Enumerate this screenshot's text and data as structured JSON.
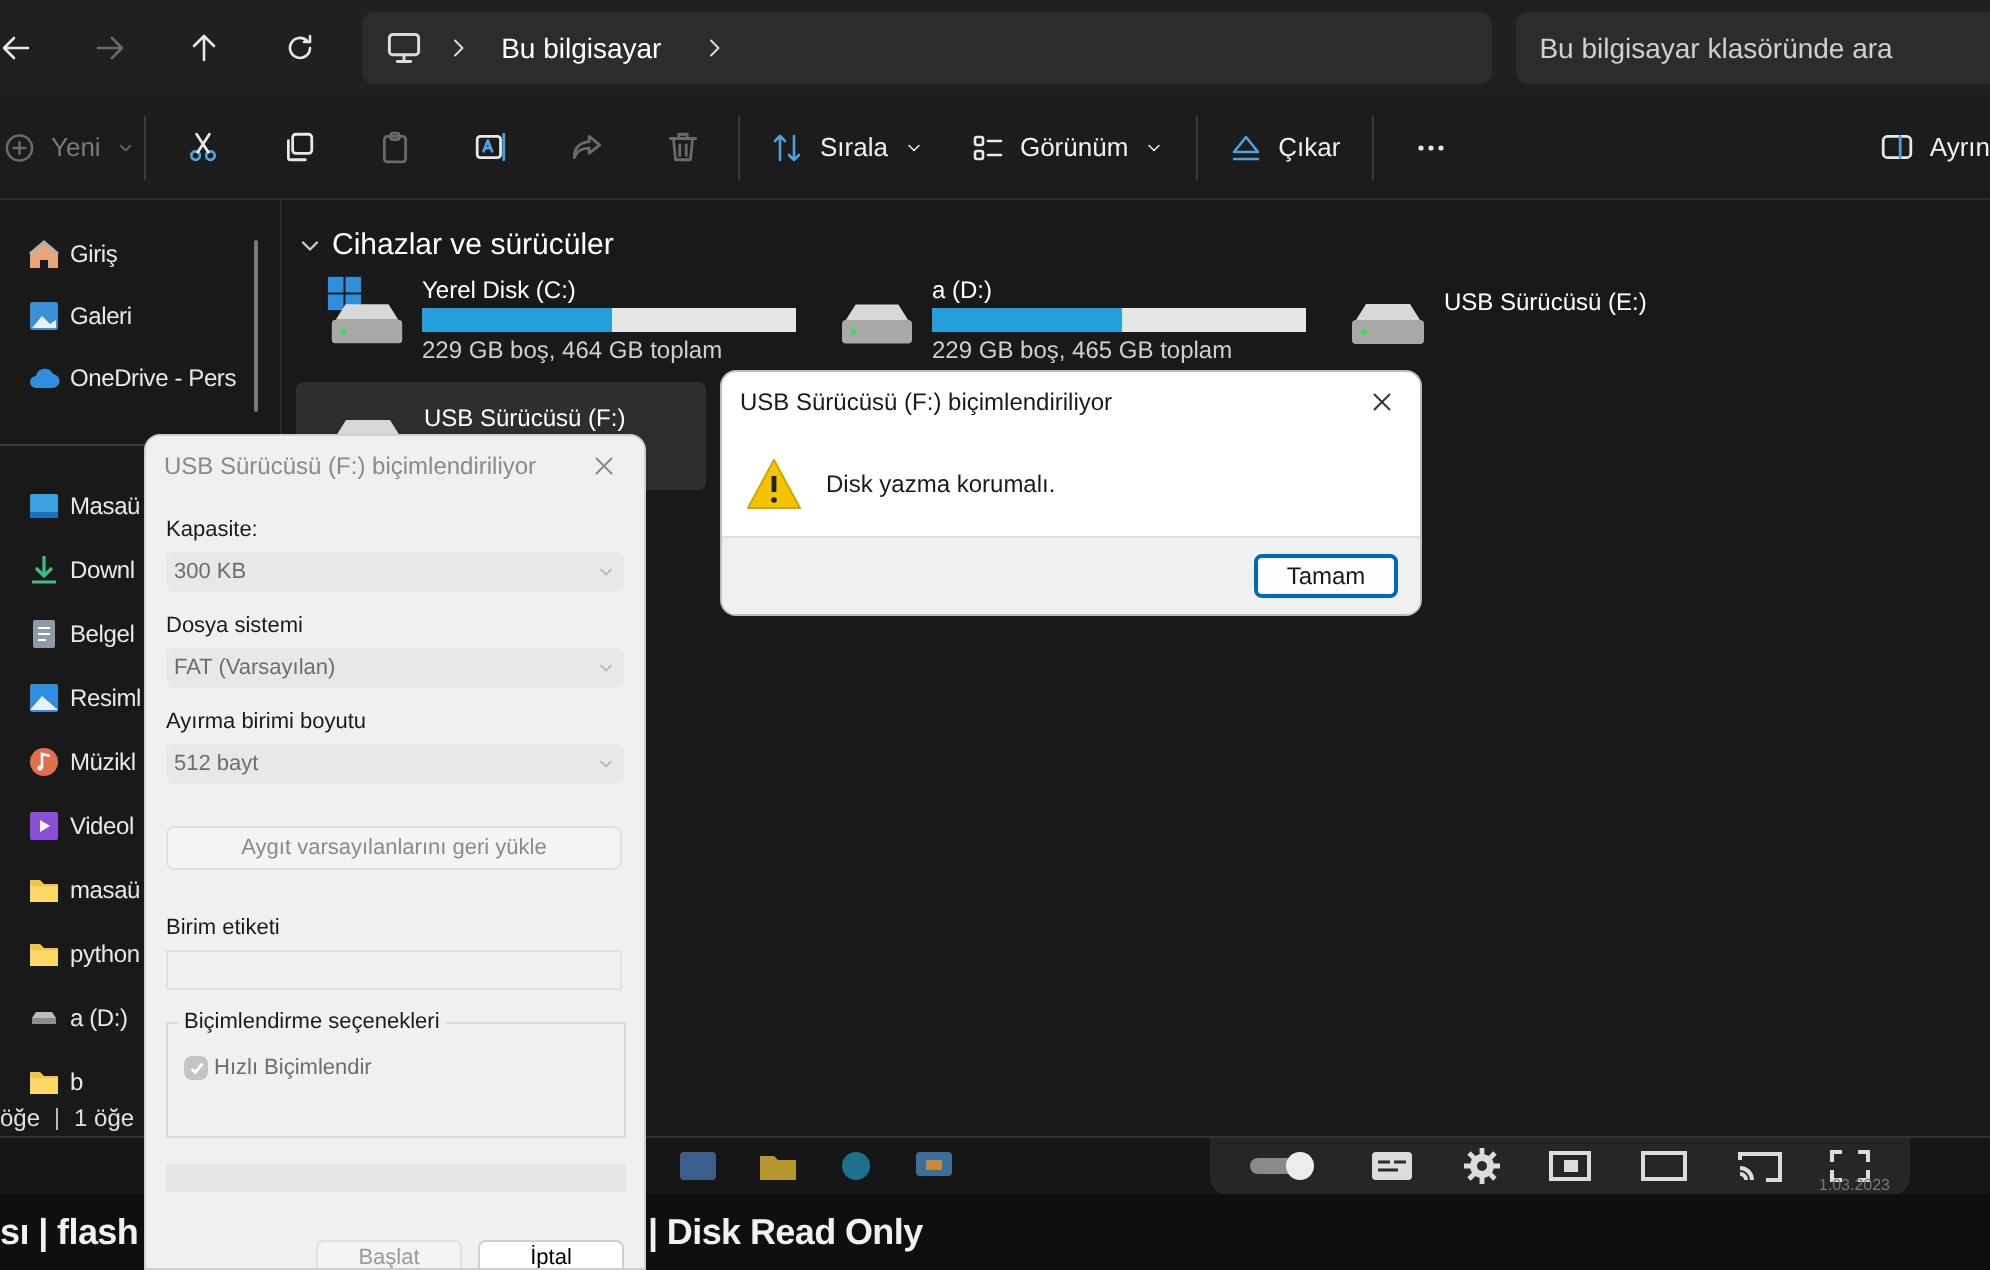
{
  "nav": {
    "buttons": [
      {
        "kind": "back",
        "disabled": false
      },
      {
        "kind": "forward",
        "disabled": true
      },
      {
        "kind": "up",
        "disabled": false
      },
      {
        "kind": "refresh",
        "disabled": false
      }
    ],
    "address": [
      "Bu bilgisayar"
    ],
    "search": {
      "placeholder": "Bu bilgisayar klasöründe ara"
    }
  },
  "toolbar": {
    "groups": [
      [
        {
          "kind": "plus",
          "label": "Yeni",
          "dropdown": true,
          "disabled": true
        }
      ],
      [
        {
          "kind": "cut",
          "disabled": false
        },
        {
          "kind": "copy",
          "disabled": false
        },
        {
          "kind": "paste",
          "disabled": true
        },
        {
          "kind": "rename",
          "disabled": false
        },
        {
          "kind": "share",
          "disabled": true
        },
        {
          "kind": "delete",
          "disabled": true
        }
      ],
      [
        {
          "kind": "sort",
          "label": "Sırala",
          "dropdown": true,
          "disabled": false
        },
        {
          "kind": "view",
          "label": "Görünüm",
          "dropdown": true,
          "disabled": false
        }
      ],
      [
        {
          "kind": "eject",
          "label": "Çıkar",
          "dropdown": false,
          "disabled": false
        }
      ],
      [
        {
          "kind": "more",
          "disabled": false
        }
      ]
    ],
    "right": {
      "kind": "panel",
      "label": "Ayrın"
    }
  },
  "sidebar": {
    "groups": [
      [
        {
          "kind": "home",
          "label": "Giriş"
        },
        {
          "kind": "gallery",
          "label": "Galeri"
        },
        {
          "kind": "cloud",
          "label": "OneDrive - Pers"
        }
      ],
      [
        {
          "kind": "desktop",
          "label": "Masaü"
        },
        {
          "kind": "download",
          "label": "Downl"
        },
        {
          "kind": "document",
          "label": "Belgel"
        },
        {
          "kind": "pictures",
          "label": "Resiml"
        },
        {
          "kind": "music",
          "label": "Müzikl"
        },
        {
          "kind": "video",
          "label": "Videol"
        },
        {
          "kind": "folder",
          "label": "masaü"
        },
        {
          "kind": "folder",
          "label": "python"
        },
        {
          "kind": "drive",
          "label": "a (D:)"
        },
        {
          "kind": "folder",
          "label": "b"
        }
      ]
    ]
  },
  "section": {
    "title": "Cihazlar ve sürücüler",
    "expanded": true
  },
  "drives": [
    {
      "kind": "system",
      "name": "Yerel Disk (C:)",
      "level": 0.51,
      "detail": "229 GB boş, 464 GB toplam",
      "selected": false
    },
    {
      "kind": "disk",
      "name": "a (D:)",
      "level": 0.51,
      "detail": "229 GB boş, 465 GB toplam",
      "selected": false
    },
    {
      "kind": "usb",
      "name": "USB Sürücüsü (E:)",
      "selected": false
    },
    {
      "kind": "usb",
      "name": "USB Sürücüsü (F:)",
      "selected": true
    }
  ],
  "status_bar": {
    "items": [
      "öğe",
      "1 öğe"
    ]
  },
  "format_dialog": {
    "title": "USB Sürücüsü (F:) biçimlendiriliyor",
    "fields": [
      {
        "kind": "select",
        "label": "Kapasite:",
        "value": "300 KB",
        "disabled": true
      },
      {
        "kind": "select",
        "label": "Dosya sistemi",
        "value": "FAT (Varsayılan)",
        "disabled": true
      },
      {
        "kind": "select",
        "label": "Ayırma birimi boyutu",
        "value": "512 bayt",
        "disabled": true
      },
      {
        "kind": "button",
        "label": "Aygıt varsayılanlarını geri yükle",
        "disabled": true
      },
      {
        "kind": "text",
        "label": "Birim etiketi",
        "disabled": true
      }
    ],
    "options": {
      "title": "Biçimlendirme seçenekleri",
      "checkbox": {
        "label": "Hızlı Biçimlendir",
        "checked": true,
        "disabled": true
      }
    },
    "progress": {
      "level": 0
    },
    "buttons": [
      {
        "label": "Başlat",
        "disabled": true
      },
      {
        "label": "İptal",
        "disabled": false
      }
    ]
  },
  "message_dialog": {
    "title": "USB Sürücüsü (F:) biçimlendiriliyor",
    "kind": "warning",
    "message": "Disk yazma korumalı.",
    "buttons": [
      {
        "label": "Tamam",
        "default": true
      }
    ]
  },
  "player": {
    "date": "1.03.2023"
  },
  "video_title": [
    "sı | flash",
    "| Disk Read Only"
  ]
}
